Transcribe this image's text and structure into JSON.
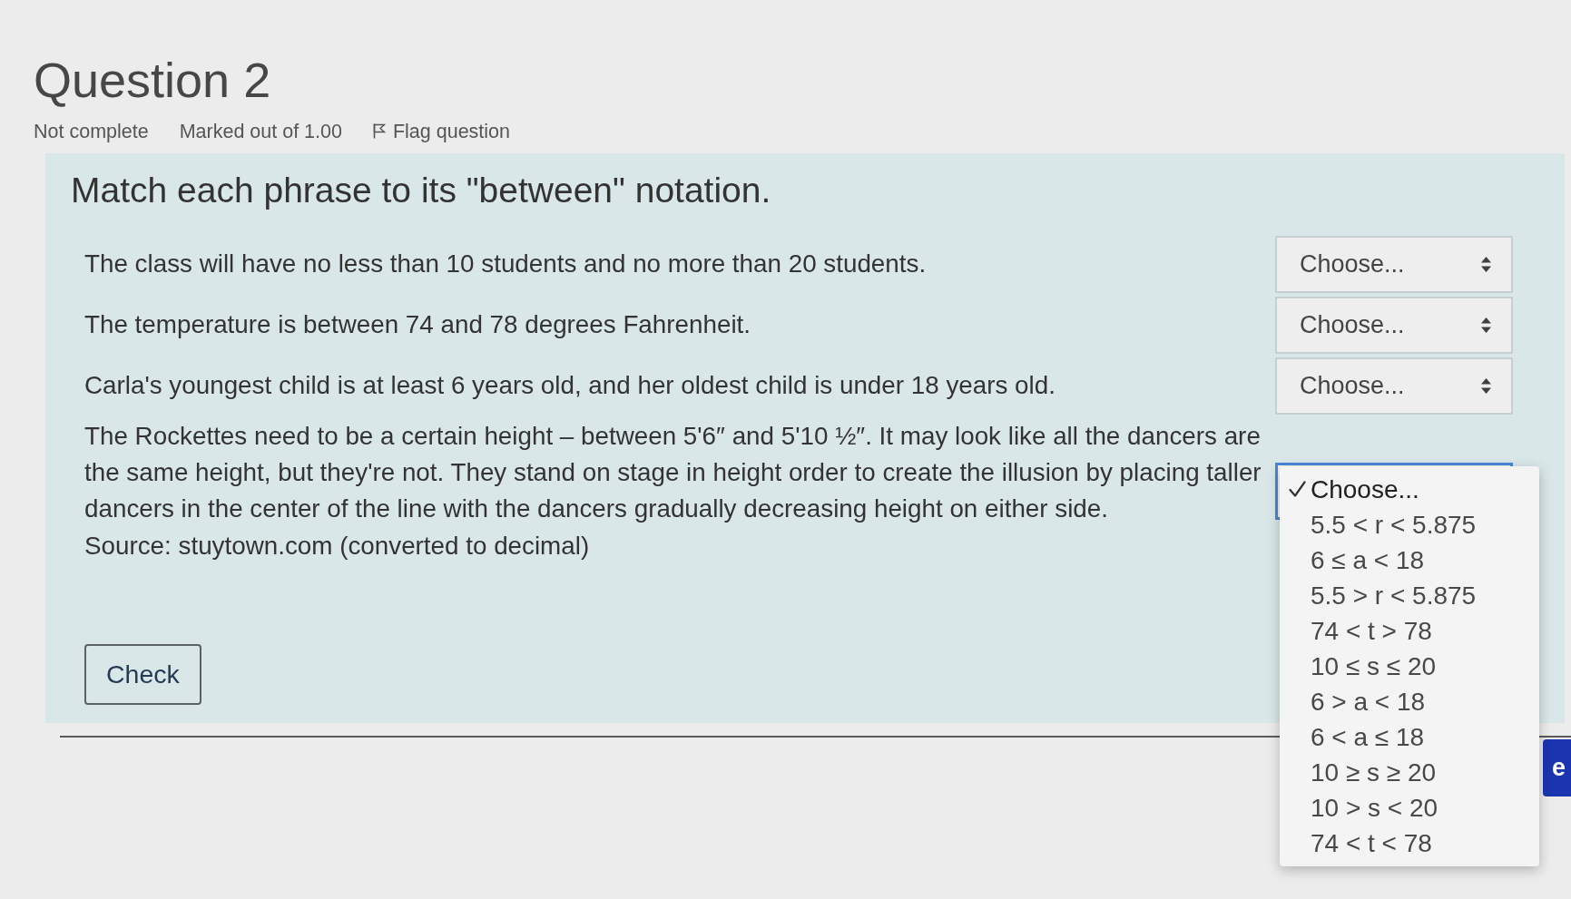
{
  "question": {
    "title": "Question 2",
    "status": "Not complete",
    "mark": "Marked out of 1.00",
    "flag": {
      "label": "Flag question",
      "flagged": false
    }
  },
  "prompt": "Match each phrase to its \"between\" notation.",
  "rows": [
    {
      "text": "The class will have no less than 10 students and no more than 20 students.",
      "select": {
        "value": "Choose...",
        "open": false
      }
    },
    {
      "text": "The temperature is between 74 and 78 degrees Fahrenheit.",
      "select": {
        "value": "Choose...",
        "open": false
      }
    },
    {
      "text": "Carla's youngest child is at least 6 years old, and her oldest child is under 18 years old.",
      "select": {
        "value": "Choose...",
        "open": false
      }
    },
    {
      "text": "The Rockettes need to be a certain height – between 5'6″ and 5'10 ½″. It may look like all the dancers are the same height, but they're not. They stand on stage in height order to create the illusion by placing taller dancers in the center of the line with the dancers gradually decreasing height on either side.",
      "source": "Source: stuytown.com (converted to decimal)",
      "select": {
        "open": true,
        "options": [
          {
            "label": "Choose...",
            "selected": true
          },
          {
            "label": "5.5 < r < 5.875",
            "selected": false
          },
          {
            "label": "6 ≤ a < 18",
            "selected": false
          },
          {
            "label": "5.5 > r < 5.875",
            "selected": false
          },
          {
            "label": "74 < t > 78",
            "selected": false
          },
          {
            "label": "10 ≤ s ≤ 20",
            "selected": false
          },
          {
            "label": "6 > a < 18",
            "selected": false
          },
          {
            "label": "6 < a ≤ 18",
            "selected": false
          },
          {
            "label": "10 ≥ s ≥ 20",
            "selected": false
          },
          {
            "label": "10 > s < 20",
            "selected": false
          },
          {
            "label": "74 < t < 78",
            "selected": false
          }
        ]
      }
    }
  ],
  "check_button": {
    "label": "Check"
  },
  "next_button": {
    "label": "e"
  }
}
